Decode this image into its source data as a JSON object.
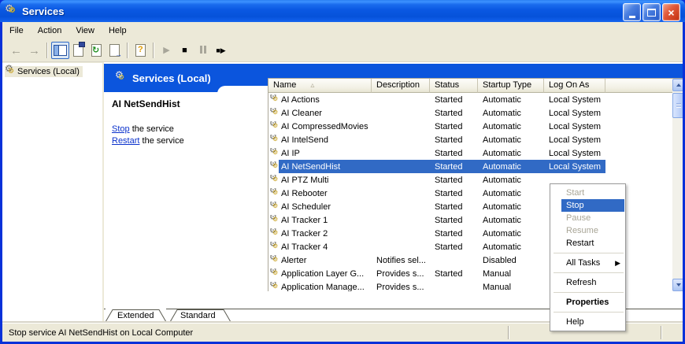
{
  "window": {
    "title": "Services"
  },
  "menu_bar": {
    "items": [
      "File",
      "Action",
      "View",
      "Help"
    ]
  },
  "icons": {
    "gear": "⚙",
    "back_arrow": "←",
    "forward_arrow": "→",
    "play": "▶",
    "stop_square": "■",
    "restart": "■▶",
    "refresh_arrows": "↻",
    "export_arrow": "→",
    "help_question": "?",
    "sort_ascending": "▵",
    "submenu_arrow": "▶",
    "close": "×"
  },
  "tree": {
    "root_label": "Services (Local)"
  },
  "banner": {
    "title": "Services (Local)"
  },
  "info_panel": {
    "service_name": "AI NetSendHist",
    "lines": [
      {
        "link": "Stop",
        "rest": " the service"
      },
      {
        "link": "Restart",
        "rest": " the service"
      }
    ]
  },
  "list": {
    "columns": [
      {
        "label": "Name",
        "sorted": true
      },
      {
        "label": "Description"
      },
      {
        "label": "Status"
      },
      {
        "label": "Startup Type"
      },
      {
        "label": "Log On As"
      }
    ],
    "rows": [
      {
        "name": "AI Actions",
        "description": "",
        "status": "Started",
        "startup_type": "Automatic",
        "log_on_as": "Local System",
        "selected": false
      },
      {
        "name": "AI Cleaner",
        "description": "",
        "status": "Started",
        "startup_type": "Automatic",
        "log_on_as": "Local System",
        "selected": false
      },
      {
        "name": "AI CompressedMovies",
        "description": "",
        "status": "Started",
        "startup_type": "Automatic",
        "log_on_as": "Local System",
        "selected": false
      },
      {
        "name": "AI IntelSend",
        "description": "",
        "status": "Started",
        "startup_type": "Automatic",
        "log_on_as": "Local System",
        "selected": false
      },
      {
        "name": "AI IP",
        "description": "",
        "status": "Started",
        "startup_type": "Automatic",
        "log_on_as": "Local System",
        "selected": false
      },
      {
        "name": "AI NetSendHist",
        "description": "",
        "status": "Started",
        "startup_type": "Automatic",
        "log_on_as": "Local System",
        "selected": true
      },
      {
        "name": "AI PTZ Multi",
        "description": "",
        "status": "Started",
        "startup_type": "Automatic",
        "log_on_as": "",
        "selected": false
      },
      {
        "name": "AI Rebooter",
        "description": "",
        "status": "Started",
        "startup_type": "Automatic",
        "log_on_as": "",
        "selected": false
      },
      {
        "name": "AI Scheduler",
        "description": "",
        "status": "Started",
        "startup_type": "Automatic",
        "log_on_as": "",
        "selected": false
      },
      {
        "name": "AI Tracker 1",
        "description": "",
        "status": "Started",
        "startup_type": "Automatic",
        "log_on_as": "",
        "selected": false
      },
      {
        "name": "AI Tracker 2",
        "description": "",
        "status": "Started",
        "startup_type": "Automatic",
        "log_on_as": "",
        "selected": false
      },
      {
        "name": "AI Tracker 4",
        "description": "",
        "status": "Started",
        "startup_type": "Automatic",
        "log_on_as": "",
        "selected": false
      },
      {
        "name": "Alerter",
        "description": "Notifies sel...",
        "status": "",
        "startup_type": "Disabled",
        "log_on_as": "",
        "selected": false
      },
      {
        "name": "Application Layer G...",
        "description": "Provides s...",
        "status": "Started",
        "startup_type": "Manual",
        "log_on_as": "",
        "selected": false
      },
      {
        "name": "Application Manage...",
        "description": "Provides s...",
        "status": "",
        "startup_type": "Manual",
        "log_on_as": "",
        "selected": false
      }
    ]
  },
  "context_menu": {
    "items": [
      {
        "label": "Start",
        "state": "disabled"
      },
      {
        "label": "Stop",
        "state": "highlighted"
      },
      {
        "label": "Pause",
        "state": "disabled"
      },
      {
        "label": "Resume",
        "state": "disabled"
      },
      {
        "label": "Restart",
        "state": "normal"
      },
      {
        "separator": true
      },
      {
        "label": "All Tasks",
        "state": "normal",
        "submenu": true
      },
      {
        "separator": true
      },
      {
        "label": "Refresh",
        "state": "normal"
      },
      {
        "separator": true
      },
      {
        "label": "Properties",
        "state": "normal",
        "bold": true
      },
      {
        "separator": true
      },
      {
        "label": "Help",
        "state": "normal"
      }
    ]
  },
  "tabs": {
    "items": [
      {
        "label": "Extended",
        "active": true
      },
      {
        "label": "Standard",
        "active": false
      }
    ]
  },
  "status_bar": {
    "text": "Stop service AI NetSendHist on Local Computer"
  },
  "colors": {
    "selection_blue": "#316ac5",
    "banner_blue": "#0b55dd",
    "frame_blue": "#0831d9",
    "chrome_bg": "#ece9d8",
    "link_blue": "#0b32cc",
    "disabled_text": "#a8a596"
  }
}
